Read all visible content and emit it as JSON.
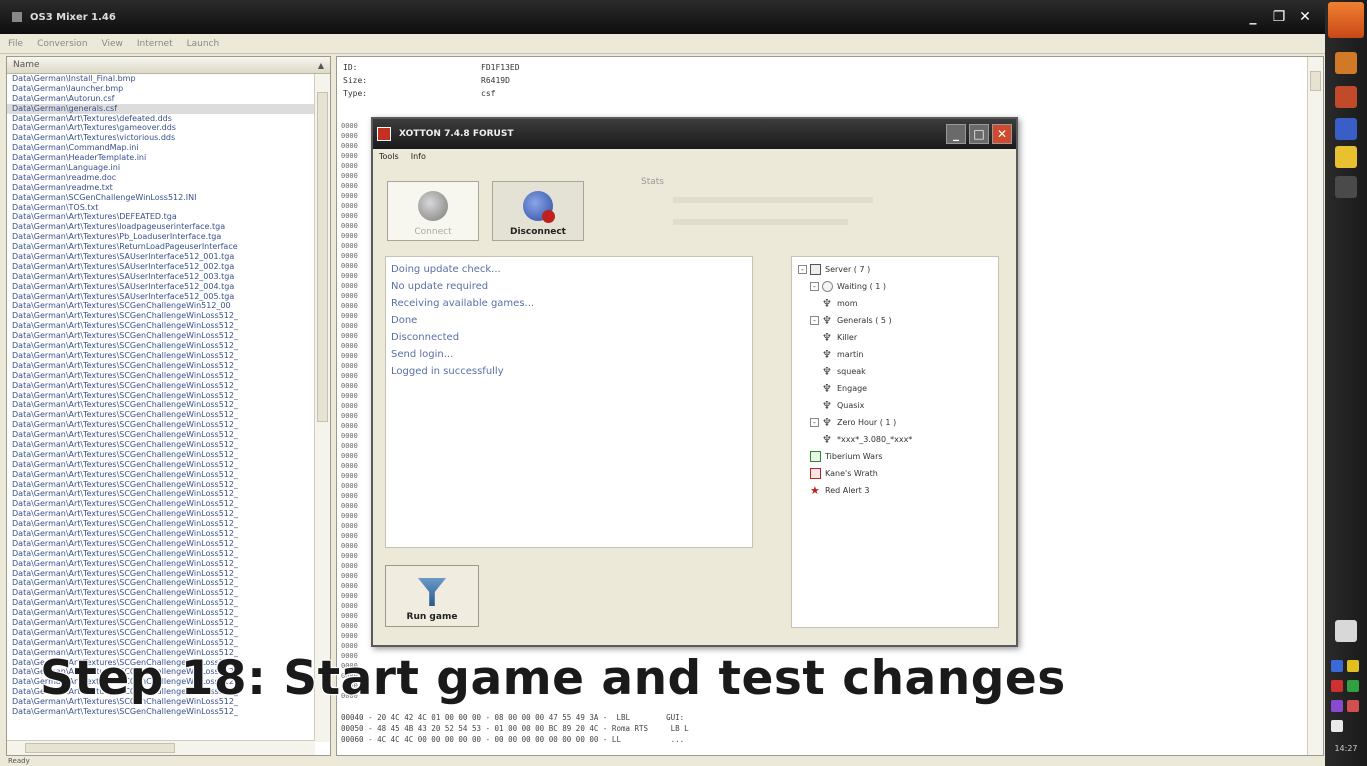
{
  "main_window": {
    "title": "OS3 Mixer 1.46",
    "menu": [
      "File",
      "Conversion",
      "View",
      "Internet",
      "Launch"
    ],
    "window_buttons": [
      "_",
      "❐",
      "✕"
    ]
  },
  "left_panel": {
    "header": "Name",
    "files": [
      "Data\\German\\Install_Final.bmp",
      "Data\\German\\launcher.bmp",
      "Data\\German\\Autorun.csf",
      "Data\\German\\generals.csf",
      "Data\\German\\Art\\Textures\\defeated.dds",
      "Data\\German\\Art\\Textures\\gameover.dds",
      "Data\\German\\Art\\Textures\\victorious.dds",
      "Data\\German\\CommandMap.ini",
      "Data\\German\\HeaderTemplate.ini",
      "Data\\German\\Language.ini",
      "Data\\German\\readme.doc",
      "Data\\German\\readme.txt",
      "Data\\German\\SCGenChallengeWinLoss512.INI",
      "Data\\German\\TOS.txt",
      "Data\\German\\Art\\Textures\\DEFEATED.tga",
      "Data\\German\\Art\\Textures\\loadpageuserinterface.tga",
      "Data\\German\\Art\\Textures\\Pb_LoaduserInterface.tga",
      "Data\\German\\Art\\Textures\\ReturnLoadPageuserInterface",
      "Data\\German\\Art\\Textures\\SAUserInterface512_001.tga",
      "Data\\German\\Art\\Textures\\SAUserInterface512_002.tga",
      "Data\\German\\Art\\Textures\\SAUserInterface512_003.tga",
      "Data\\German\\Art\\Textures\\SAUserInterface512_004.tga",
      "Data\\German\\Art\\Textures\\SAUserInterface512_005.tga",
      "Data\\German\\Art\\Textures\\SCGenChallengeWin512_00",
      "Data\\German\\Art\\Textures\\SCGenChallengeWinLoss512_",
      "Data\\German\\Art\\Textures\\SCGenChallengeWinLoss512_",
      "Data\\German\\Art\\Textures\\SCGenChallengeWinLoss512_",
      "Data\\German\\Art\\Textures\\SCGenChallengeWinLoss512_",
      "Data\\German\\Art\\Textures\\SCGenChallengeWinLoss512_",
      "Data\\German\\Art\\Textures\\SCGenChallengeWinLoss512_",
      "Data\\German\\Art\\Textures\\SCGenChallengeWinLoss512_",
      "Data\\German\\Art\\Textures\\SCGenChallengeWinLoss512_",
      "Data\\German\\Art\\Textures\\SCGenChallengeWinLoss512_",
      "Data\\German\\Art\\Textures\\SCGenChallengeWinLoss512_",
      "Data\\German\\Art\\Textures\\SCGenChallengeWinLoss512_",
      "Data\\German\\Art\\Textures\\SCGenChallengeWinLoss512_",
      "Data\\German\\Art\\Textures\\SCGenChallengeWinLoss512_",
      "Data\\German\\Art\\Textures\\SCGenChallengeWinLoss512_",
      "Data\\German\\Art\\Textures\\SCGenChallengeWinLoss512_",
      "Data\\German\\Art\\Textures\\SCGenChallengeWinLoss512_",
      "Data\\German\\Art\\Textures\\SCGenChallengeWinLoss512_",
      "Data\\German\\Art\\Textures\\SCGenChallengeWinLoss512_",
      "Data\\German\\Art\\Textures\\SCGenChallengeWinLoss512_",
      "Data\\German\\Art\\Textures\\SCGenChallengeWinLoss512_",
      "Data\\German\\Art\\Textures\\SCGenChallengeWinLoss512_",
      "Data\\German\\Art\\Textures\\SCGenChallengeWinLoss512_",
      "Data\\German\\Art\\Textures\\SCGenChallengeWinLoss512_",
      "Data\\German\\Art\\Textures\\SCGenChallengeWinLoss512_",
      "Data\\German\\Art\\Textures\\SCGenChallengeWinLoss512_",
      "Data\\German\\Art\\Textures\\SCGenChallengeWinLoss512_",
      "Data\\German\\Art\\Textures\\SCGenChallengeWinLoss512_",
      "Data\\German\\Art\\Textures\\SCGenChallengeWinLoss512_",
      "Data\\German\\Art\\Textures\\SCGenChallengeWinLoss512_",
      "Data\\German\\Art\\Textures\\SCGenChallengeWinLoss512_",
      "Data\\German\\Art\\Textures\\SCGenChallengeWinLoss512_",
      "Data\\German\\Art\\Textures\\SCGenChallengeWinLoss512_",
      "Data\\German\\Art\\Textures\\SCGenChallengeWinLoss512_",
      "Data\\German\\Art\\Textures\\SCGenChallengeWinLoss512_",
      "Data\\German\\Art\\Textures\\SCGenChallengeWinLoss512_",
      "Data\\German\\Art\\Textures\\SCGenChallengeWinLoss512_",
      "Data\\German\\Art\\Textures\\SCGenChallengeWinLoss512_",
      "Data\\German\\Art\\Textures\\SCGenChallengeWinLoss512_",
      "Data\\German\\Art\\Textures\\SCGenChallengeWinLoss512_",
      "Data\\German\\Art\\Textures\\SCGenChallengeWinLoss512_",
      "Data\\German\\Art\\Textures\\SCGenChallengeWinLoss512_"
    ],
    "selected_index": 3
  },
  "right_panel": {
    "info": [
      {
        "key": "ID:",
        "value": "FD1F13ED"
      },
      {
        "key": "Size:",
        "value": "R6419D"
      },
      {
        "key": "Type:",
        "value": "csf"
      }
    ],
    "hex_prefix": "0000",
    "hex_bottom_lines": [
      "00040 - 20 4C 42 4C 01 00 00 00 - 08 00 00 00 47 55 49 3A -  LBL        GUI:",
      "00050 - 48 45 4B 43 20 52 54 53 - 01 00 00 00 BC 89 20 4C - Roma RTS     LB L",
      "00060 - 4C 4C 4C 00 00 00 00 00 - 00 00 00 00 00 00 00 00 - LL           ..."
    ]
  },
  "dialog": {
    "title": "XOTTON 7.4.8 FORUST",
    "menu": [
      "Tools",
      "Info"
    ],
    "connect_label": "Connect",
    "disconnect_label": "Disconnect",
    "stats_label": "Stats",
    "log": [
      "Doing update check...",
      "No update required",
      "Receiving available games...",
      "Done",
      "Disconnected",
      "Send login...",
      "Logged in successfully"
    ],
    "tree": [
      {
        "label": "Server ( 7 )",
        "indent": 0,
        "icon": "server",
        "expander": "-"
      },
      {
        "label": "Waiting ( 1 )",
        "indent": 1,
        "icon": "wait",
        "expander": "-"
      },
      {
        "label": "mom",
        "indent": 2,
        "icon": "user",
        "expander": ""
      },
      {
        "label": "Generals ( 5 )",
        "indent": 1,
        "icon": "user",
        "expander": "-"
      },
      {
        "label": "Killer",
        "indent": 2,
        "icon": "user",
        "expander": ""
      },
      {
        "label": "martin",
        "indent": 2,
        "icon": "user",
        "expander": ""
      },
      {
        "label": "squeak",
        "indent": 2,
        "icon": "user",
        "expander": ""
      },
      {
        "label": "Engage",
        "indent": 2,
        "icon": "user",
        "expander": ""
      },
      {
        "label": "Quasix",
        "indent": 2,
        "icon": "user",
        "expander": ""
      },
      {
        "label": "Zero Hour ( 1 )",
        "indent": 1,
        "icon": "user",
        "expander": "-"
      },
      {
        "label": "*xxx*_3.080_*xxx*",
        "indent": 2,
        "icon": "user",
        "expander": ""
      },
      {
        "label": "Tiberium Wars",
        "indent": 1,
        "icon": "game-green",
        "expander": ""
      },
      {
        "label": "Kane's Wrath",
        "indent": 1,
        "icon": "game-red",
        "expander": ""
      },
      {
        "label": "Red Alert 3",
        "indent": 1,
        "icon": "star",
        "expander": ""
      }
    ],
    "run_game_label": "Run game"
  },
  "caption": "Step 18: Start game and test changes",
  "status_bar": "Ready",
  "taskbar": {
    "clock": "14:27"
  },
  "colors": {
    "log_text": "#5b6fa6",
    "file_text": "#38508c",
    "title_dark": "#1a1a1a",
    "taskbar_start": "#f08030"
  }
}
